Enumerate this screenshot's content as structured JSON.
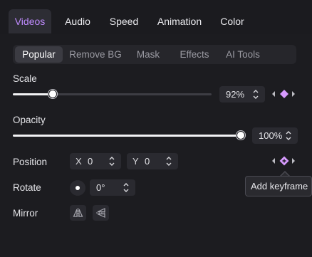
{
  "tabs": [
    {
      "label": "Videos",
      "active": true
    },
    {
      "label": "Audio",
      "active": false
    },
    {
      "label": "Speed",
      "active": false
    },
    {
      "label": "Animation",
      "active": false
    },
    {
      "label": "Color",
      "active": false
    }
  ],
  "subtabs": [
    {
      "label": "Popular",
      "active": true
    },
    {
      "label": "Remove BG",
      "active": false
    },
    {
      "label": "Mask",
      "active": false
    },
    {
      "label": "Effects",
      "active": false
    },
    {
      "label": "AI Tools",
      "active": false
    }
  ],
  "scale": {
    "label": "Scale",
    "value_text": "92%",
    "fraction": 0.2
  },
  "opacity": {
    "label": "Opacity",
    "value_text": "100%",
    "fraction": 1.0
  },
  "position": {
    "label": "Position",
    "x_axis": "X",
    "x_value": "0",
    "y_axis": "Y",
    "y_value": "0"
  },
  "rotate": {
    "label": "Rotate",
    "value_text": "0°"
  },
  "mirror": {
    "label": "Mirror"
  },
  "tooltip": {
    "text": "Add keyframe"
  },
  "colors": {
    "accent": "#c08cff",
    "keyframe_diamond": "#d79bff",
    "background": "#1c1c20"
  },
  "icons": {
    "keyframe_prev": "chevron-left-icon",
    "keyframe_add": "diamond-icon",
    "keyframe_next": "chevron-right-icon",
    "mirror_horizontal": "flip-horizontal-icon",
    "mirror_vertical": "flip-vertical-icon"
  }
}
